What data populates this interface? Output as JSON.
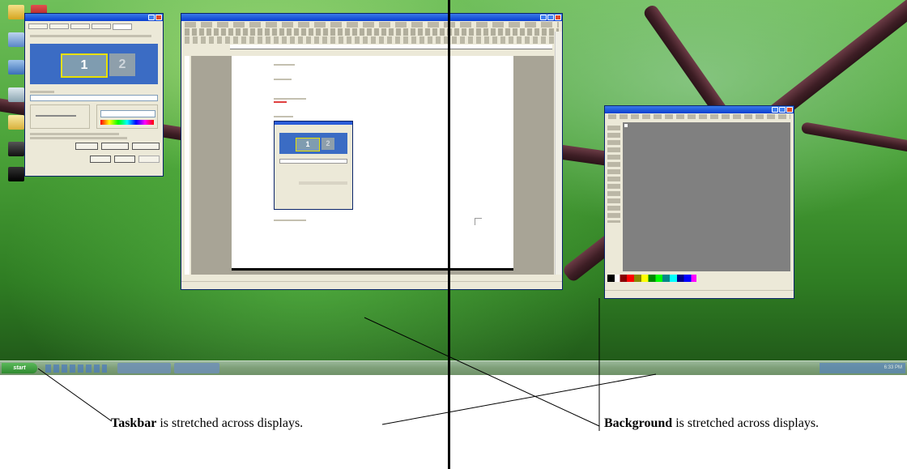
{
  "desktop": {
    "display_labels": [
      "1",
      "2"
    ],
    "taskbar": {
      "start_label": "start",
      "tray_time": "6:33 PM"
    }
  },
  "annotations": {
    "taskbar_bold": "Taskbar",
    "taskbar_rest": " is stretched across displays.",
    "background_bold": "Background",
    "background_rest": " is stretched across displays."
  },
  "colors": {
    "divider": "#000000",
    "desktop_green": "#4aa238",
    "branch": "#4a2530",
    "titlebar_blue": "#0a3fd0",
    "monitor_blue": "#2b5aa8"
  }
}
